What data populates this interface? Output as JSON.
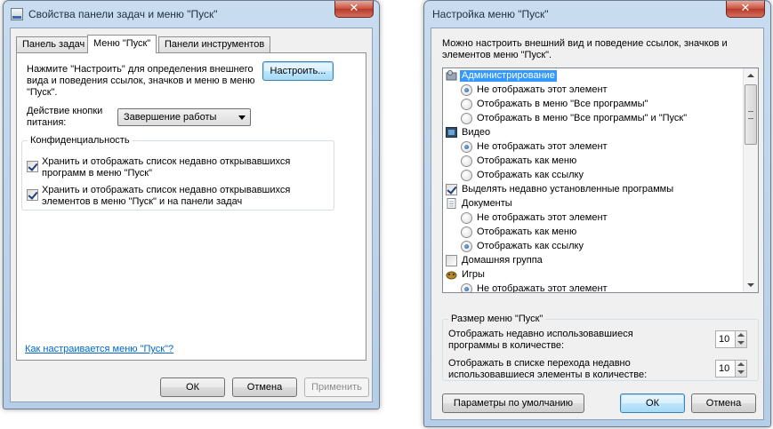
{
  "taskbar_window": {
    "title": "Свойства панели задач и меню \"Пуск\"",
    "close_glyph": "✕",
    "tabs": [
      {
        "label": "Панель задач"
      },
      {
        "label": "Меню \"Пуск\""
      },
      {
        "label": "Панели инструментов"
      }
    ],
    "description": [
      "Нажмите \"Настроить\" для определения внешнего",
      "вида и поведения ссылок, значков и меню в меню",
      "\"Пуск\"."
    ],
    "customize_button": "Настроить...",
    "power_label": [
      "Действие кнопки",
      "питания:"
    ],
    "power_value": "Завершение работы",
    "privacy_title": "Конфиденциальность",
    "privacy_options": [
      {
        "lines": [
          "Хранить и отображать список недавно открывавшихся",
          "программ в меню \"Пуск\""
        ],
        "checked": true
      },
      {
        "lines": [
          "Хранить и отображать список недавно открывавшихся",
          "элементов в меню \"Пуск\" и на панели задач"
        ],
        "checked": true
      }
    ],
    "help_link": "Как настраивается меню \"Пуск\"?",
    "buttons": {
      "ok": "ОК",
      "cancel": "Отмена",
      "apply": "Применить"
    }
  },
  "customize_window": {
    "title": "Настройка меню \"Пуск\"",
    "close_glyph": "✕",
    "intro": [
      "Можно настроить внешний вид и поведение ссылок, значков и",
      "элементов меню \"Пуск\"."
    ],
    "list_items": [
      {
        "kind": "category",
        "label": "Администрирование",
        "icon": "admin-tools-icon",
        "selected": true
      },
      {
        "kind": "radio",
        "label": "Не отображать этот элемент",
        "checked": true
      },
      {
        "kind": "radio",
        "label": "Отображать в меню \"Все программы\"",
        "checked": false
      },
      {
        "kind": "radio",
        "label": "Отображать в меню \"Все программы\" и \"Пуск\"",
        "checked": false
      },
      {
        "kind": "category",
        "label": "Видео",
        "icon": "video-icon",
        "selected": false
      },
      {
        "kind": "radio",
        "label": "Не отображать этот элемент",
        "checked": true
      },
      {
        "kind": "radio",
        "label": "Отображать как меню",
        "checked": false
      },
      {
        "kind": "radio",
        "label": "Отображать как ссылку",
        "checked": false
      },
      {
        "kind": "check",
        "label": "Выделять недавно установленные программы",
        "checked": true
      },
      {
        "kind": "category",
        "label": "Документы",
        "icon": "documents-icon",
        "selected": false
      },
      {
        "kind": "radio",
        "label": "Не отображать этот элемент",
        "checked": false
      },
      {
        "kind": "radio",
        "label": "Отображать как меню",
        "checked": false
      },
      {
        "kind": "radio",
        "label": "Отображать как ссылку",
        "checked": true
      },
      {
        "kind": "check",
        "label": "Домашняя группа",
        "checked": false
      },
      {
        "kind": "category",
        "label": "Игры",
        "icon": "games-icon",
        "selected": false
      },
      {
        "kind": "radio",
        "label": "Не отображать этот элемент",
        "checked": true
      }
    ],
    "size_group_title": "Размер меню \"Пуск\"",
    "recent_programs_label": [
      "Отображать недавно использовавшиеся",
      "программы в количестве:"
    ],
    "recent_programs_value": "10",
    "jump_list_label": [
      "Отображать в списке перехода недавно",
      "использовавшиеся элементы в количестве:"
    ],
    "jump_list_value": "10",
    "buttons": {
      "defaults": "Параметры по умолчанию",
      "ok": "ОК",
      "cancel": "Отмена"
    }
  },
  "colors": {
    "selection": "#3399ff",
    "link": "#0066cc",
    "title_glass": "#c9dcf0"
  }
}
